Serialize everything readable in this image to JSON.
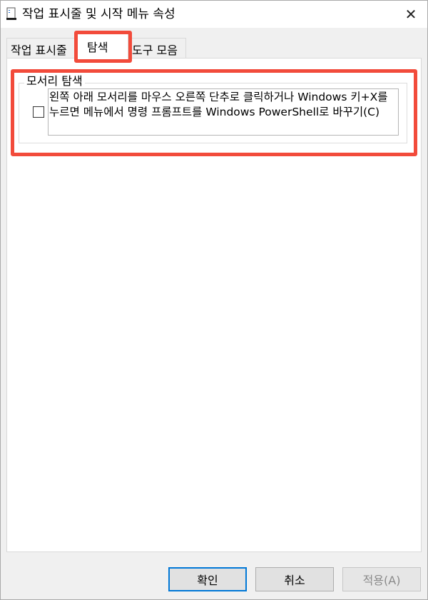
{
  "window": {
    "title": "작업 표시줄 및 시작 메뉴 속성",
    "close_glyph": "✕"
  },
  "tabs": [
    {
      "label": "작업 표시줄",
      "selected": false
    },
    {
      "label": "탐색",
      "selected": true
    },
    {
      "label": "도구 모음",
      "selected": false
    }
  ],
  "corner_navigation": {
    "group_title": "모서리 탐색",
    "option": {
      "label": "왼쪽 아래 모서리를 마우스 오른쪽 단추로 클릭하거나 Windows 키+X를 누르면 메뉴에서 명령 프롬프트를 Windows PowerShell로 바꾸기(C)",
      "checked": false
    }
  },
  "buttons": {
    "ok": "확인",
    "cancel": "취소",
    "apply": "적용(A)"
  },
  "colors": {
    "highlight": "#f24b3b",
    "focus_border": "#0078d7"
  }
}
